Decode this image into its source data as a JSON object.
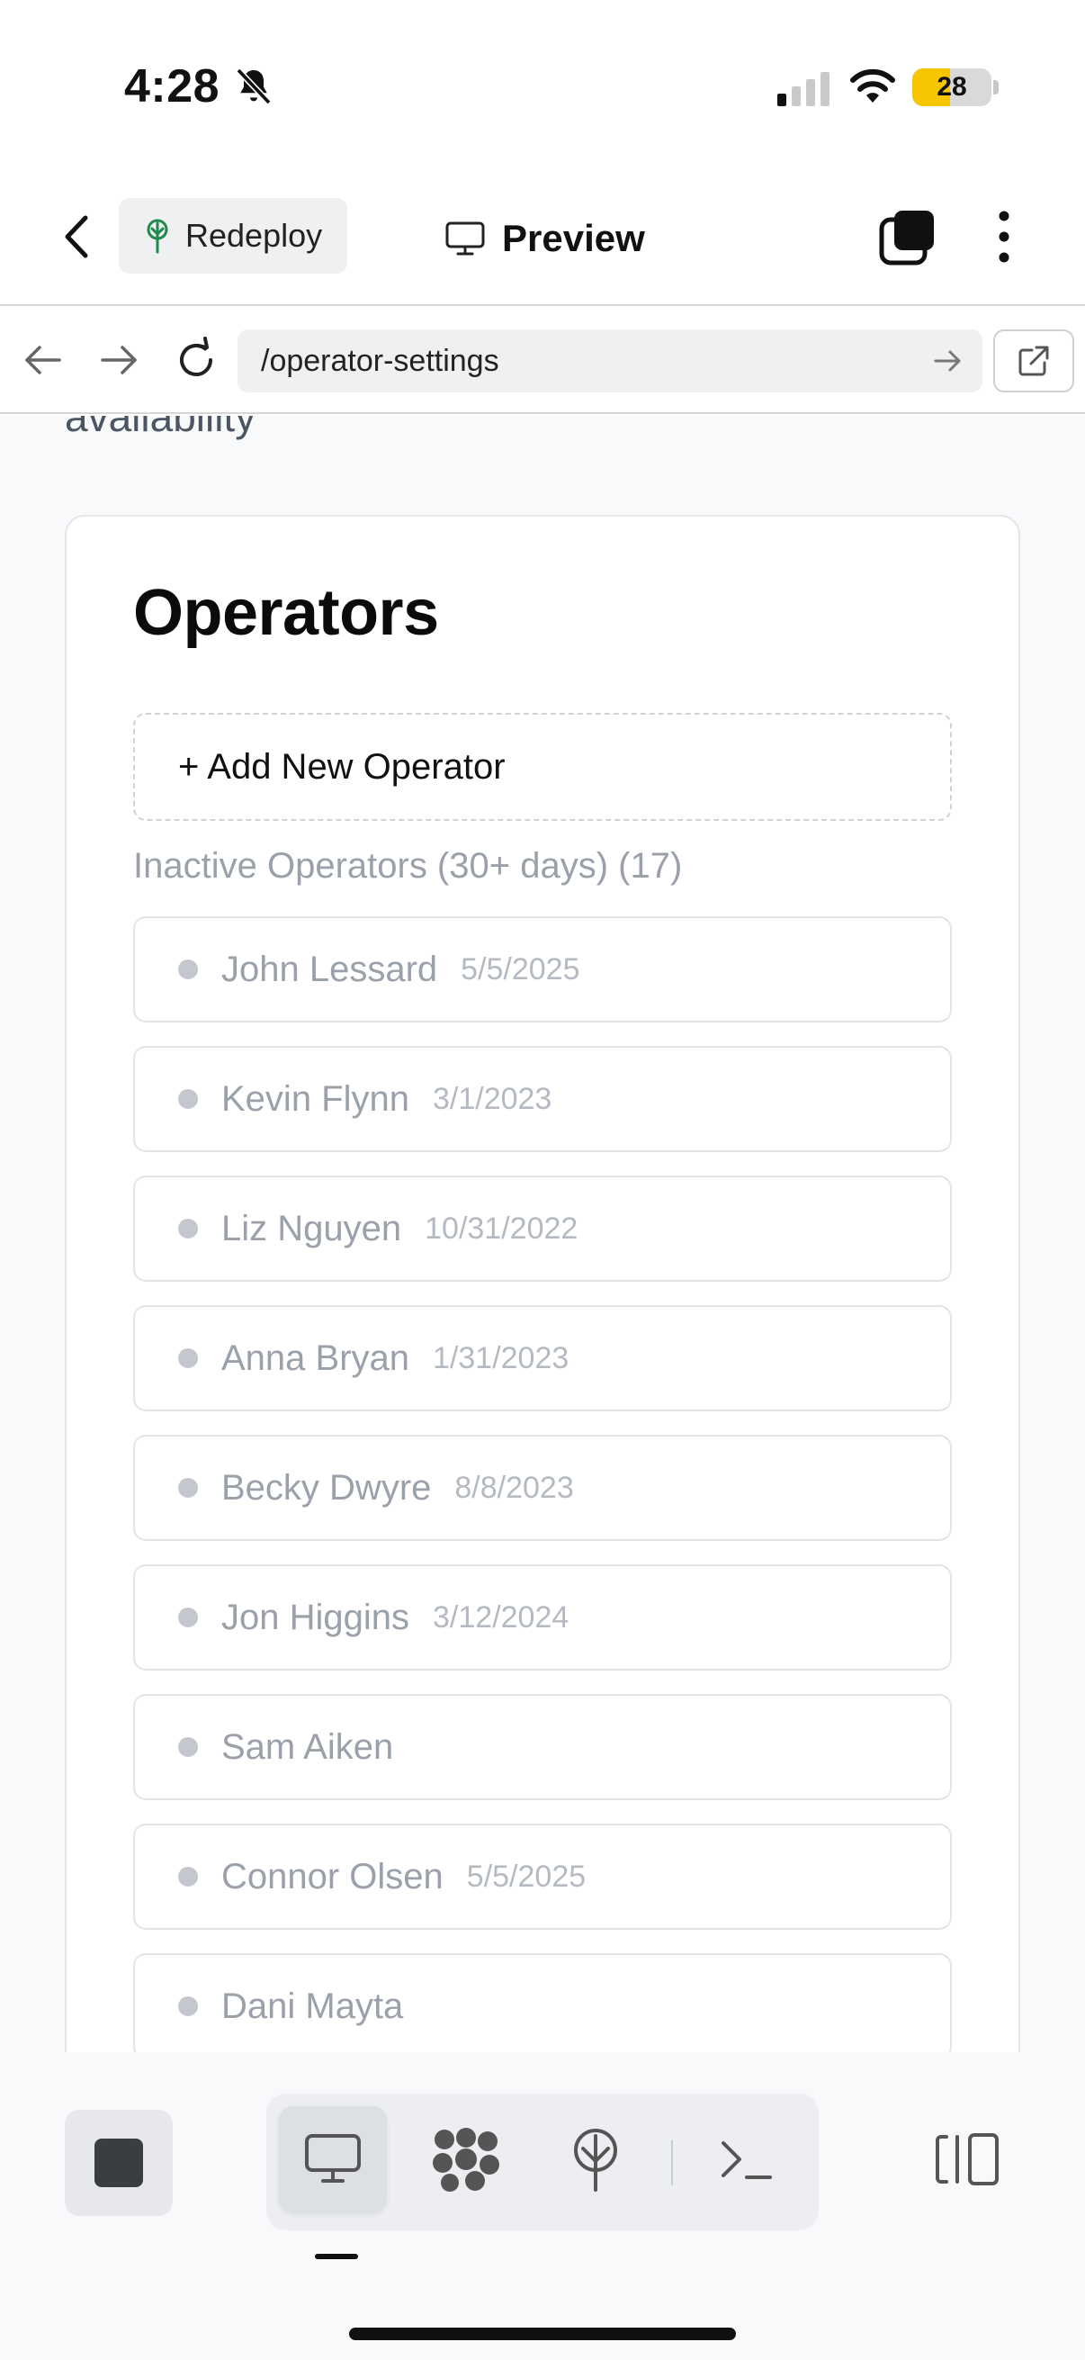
{
  "status_bar": {
    "time": "4:28",
    "battery": "28",
    "battery_fraction": 0.28
  },
  "header": {
    "redeploy_label": "Redeploy",
    "preview_label": "Preview"
  },
  "url_bar": {
    "url": "/operator-settings"
  },
  "page": {
    "cut_off_text": "availability",
    "card_title": "Operators",
    "add_button_label": "+ Add New Operator",
    "section_label": "Inactive Operators (30+ days) (17)",
    "operators": [
      {
        "name": "John Lessard",
        "date": "5/5/2025"
      },
      {
        "name": "Kevin Flynn",
        "date": "3/1/2023"
      },
      {
        "name": "Liz Nguyen",
        "date": "10/31/2022"
      },
      {
        "name": "Anna Bryan",
        "date": "1/31/2023"
      },
      {
        "name": "Becky Dwyre",
        "date": "8/8/2023"
      },
      {
        "name": "Jon Higgins",
        "date": "3/12/2024"
      },
      {
        "name": "Sam Aiken",
        "date": ""
      },
      {
        "name": "Connor Olsen",
        "date": "5/5/2025"
      },
      {
        "name": "Dani Mayta",
        "date": ""
      }
    ]
  },
  "toolbar": {
    "icons": [
      "stop-icon",
      "desktop-preview-icon",
      "cluster-icon",
      "deploy-icon",
      "terminal-icon",
      "split-view-icon"
    ],
    "active_tool": "desktop-preview-icon"
  },
  "colors": {
    "battery_accent": "#f7c600",
    "redeploy_accent": "#1f8a4c",
    "muted_text": "#9aa1ab"
  }
}
